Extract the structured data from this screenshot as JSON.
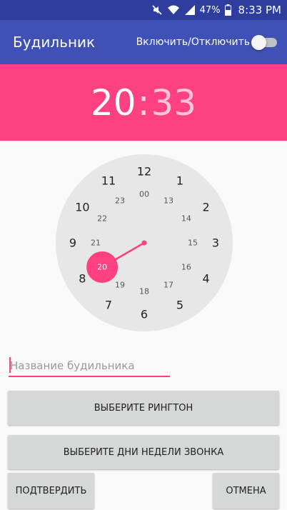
{
  "status_bar": {
    "battery": "47%",
    "time": "8:33 PM",
    "icons": [
      "mute-icon",
      "wifi-icon",
      "signal-icon",
      "battery-icon"
    ]
  },
  "app_bar": {
    "title": "Будильник",
    "toggle_label": "Включить/Отключить",
    "toggle_on": false
  },
  "time_display": {
    "hour": "20",
    "separator": ":",
    "minute": "33"
  },
  "clock": {
    "outer_numbers": [
      "12",
      "1",
      "2",
      "3",
      "4",
      "5",
      "6",
      "7",
      "8",
      "9",
      "10",
      "11"
    ],
    "inner_numbers": [
      "00",
      "13",
      "14",
      "15",
      "16",
      "17",
      "18",
      "19",
      "20",
      "21",
      "22",
      "23"
    ],
    "selected": "20"
  },
  "form": {
    "name_placeholder": "Название будильника",
    "name_value": ""
  },
  "buttons": {
    "ringtone": "ВЫБЕРИТЕ РИНГТОН",
    "days": "ВЫБЕРИТЕ ДНИ НЕДЕЛИ ЗВОНКА",
    "confirm": "ПОДТВЕРДИТЬ",
    "cancel": "ОТМЕНА"
  },
  "colors": {
    "primary": "#3f51b5",
    "primary_dark": "#2f3e9e",
    "accent": "#ff4081"
  }
}
